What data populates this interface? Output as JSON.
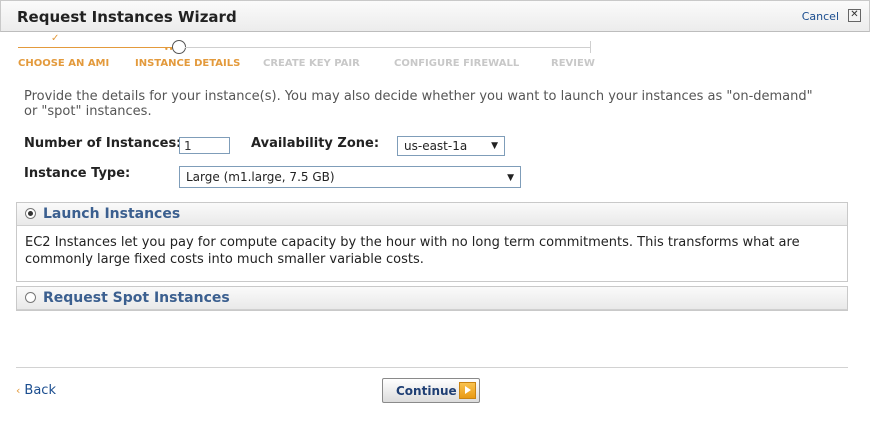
{
  "header": {
    "title": "Request Instances Wizard",
    "cancel_label": "Cancel",
    "close_glyph": "✕"
  },
  "steps": [
    {
      "label": "CHOOSE AN AMI",
      "state": "done"
    },
    {
      "label": "INSTANCE DETAILS",
      "state": "active"
    },
    {
      "label": "CREATE KEY PAIR",
      "state": "todo"
    },
    {
      "label": "CONFIGURE FIREWALL",
      "state": "todo"
    },
    {
      "label": "REVIEW",
      "state": "todo"
    }
  ],
  "intro": "Provide the details for your instance(s). You may also decide whether you want to launch your instances as \"on-demand\" or \"spot\" instances.",
  "form": {
    "instances_label": "Number of Instances:",
    "instances_value": "1",
    "zone_label": "Availability Zone:",
    "zone_value": "us-east-1a",
    "type_label": "Instance Type:",
    "type_value": "Large (m1.large, 7.5 GB)"
  },
  "launch_panel": {
    "title": "Launch Instances",
    "selected": true,
    "body": "EC2 Instances let you pay for compute capacity by the hour with no long term commitments. This transforms what are commonly large fixed costs into much smaller variable costs."
  },
  "spot_panel": {
    "title": "Request Spot Instances",
    "selected": false
  },
  "footer": {
    "back_label": "Back",
    "continue_label": "Continue"
  },
  "colors": {
    "accent": "#e39a3c",
    "link": "#1a4d8f",
    "panel_title": "#3b5f8f"
  }
}
